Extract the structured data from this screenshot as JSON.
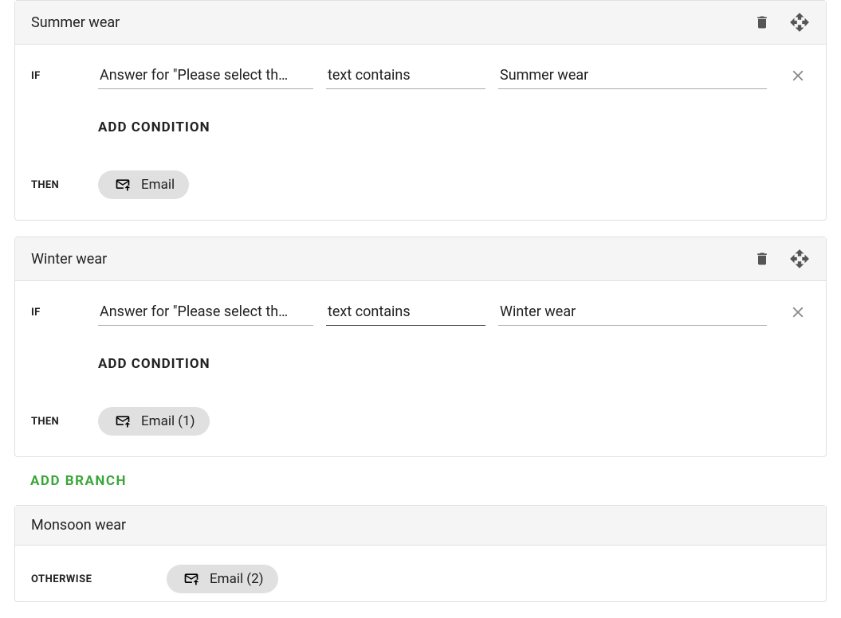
{
  "labels": {
    "if": "IF",
    "then": "THEN",
    "otherwise": "OTHERWISE",
    "add_condition": "ADD CONDITION",
    "add_branch": "ADD BRANCH"
  },
  "branches": [
    {
      "title": "Summer wear",
      "condition": {
        "answer_for": "Answer for \"Please select th…",
        "operator": "text contains",
        "value": "Summer wear"
      },
      "action_label": "Email"
    },
    {
      "title": "Winter wear",
      "condition": {
        "answer_for": "Answer for \"Please select th…",
        "operator": "text contains",
        "value": "Winter wear"
      },
      "action_label": "Email (1)"
    }
  ],
  "otherwise": {
    "title": "Monsoon wear",
    "action_label": "Email (2)"
  }
}
